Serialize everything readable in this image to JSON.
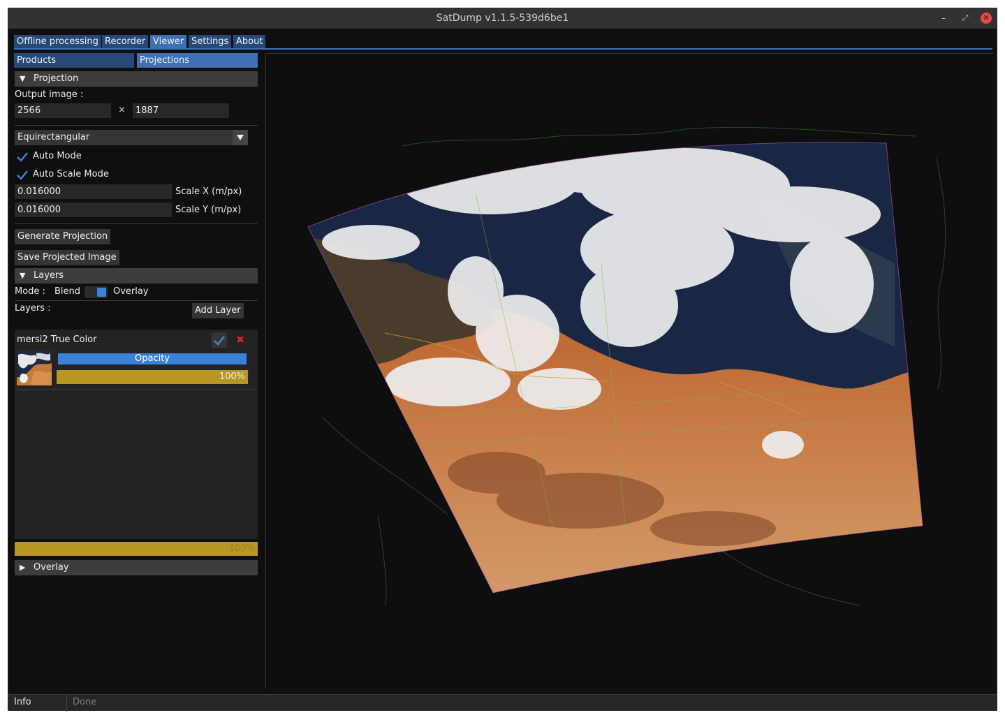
{
  "window": {
    "title": "SatDump v1.1.5-539d6be1",
    "minimize_glyph": "–",
    "maximize_glyph": "⤢",
    "close_glyph": "✕"
  },
  "tabs": [
    {
      "label": "Offline processing",
      "active": false
    },
    {
      "label": "Recorder",
      "active": false
    },
    {
      "label": "Viewer",
      "active": true
    },
    {
      "label": "Settings",
      "active": false
    },
    {
      "label": "About",
      "active": false
    }
  ],
  "subtabs": [
    {
      "label": "Products",
      "active": false
    },
    {
      "label": "Projections",
      "active": true
    }
  ],
  "projection": {
    "header": "Projection",
    "output_label": "Output image :",
    "width": "2566",
    "times": "×",
    "height": "1887",
    "projection_type": "Equirectangular",
    "auto_mode": "Auto Mode",
    "auto_scale_mode": "Auto Scale Mode",
    "scale_x_value": "0.016000",
    "scale_x_label": "Scale X (m/px)",
    "scale_y_value": "0.016000",
    "scale_y_label": "Scale Y (m/px)",
    "generate_button": "Generate Projection",
    "save_button": "Save Projected Image"
  },
  "layers": {
    "header": "Layers",
    "mode_label": "Mode :",
    "mode_blend": "Blend",
    "mode_overlay": "Overlay",
    "layers_label": "Layers :",
    "add_button": "Add Layer",
    "items": [
      {
        "name": "mersi2 True Color",
        "opacity_label": "Opacity",
        "opacity": 1.0,
        "opacity_text": "100%"
      }
    ],
    "overall_progress": 1.0,
    "overall_progress_text": "100%"
  },
  "overlay": {
    "header": "Overlay"
  },
  "status": {
    "label": "Info",
    "message": "Done"
  },
  "colors": {
    "accent": "#3f6fb4",
    "tab_inactive": "#27497a",
    "progress": "#b79722",
    "check": "#3a82d8",
    "delete": "#e02020"
  }
}
